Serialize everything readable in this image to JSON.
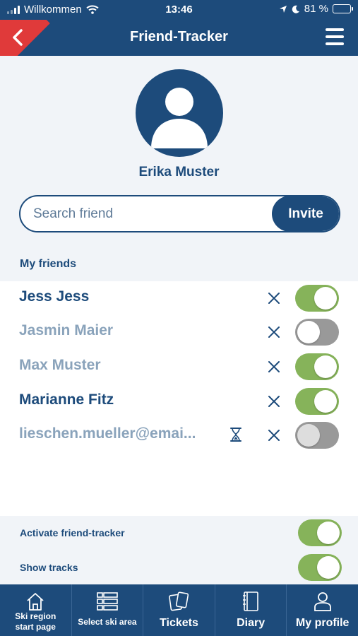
{
  "status_bar": {
    "carrier": "Willkommen",
    "time": "13:46",
    "battery": "81 %",
    "icons": [
      "signal-icon",
      "wifi-icon",
      "location-icon",
      "moon-icon",
      "battery-icon"
    ]
  },
  "header": {
    "title": "Friend-Tracker",
    "back_icon": "chevron-left-icon",
    "menu_icon": "hamburger-menu-icon"
  },
  "profile": {
    "name": "Erika Muster",
    "avatar_icon": "user-avatar-icon"
  },
  "search": {
    "placeholder": "Search friend",
    "value": "",
    "invite_label": "Invite"
  },
  "friends_section": {
    "title": "My friends",
    "friends": [
      {
        "name": "Jess Jess",
        "active": true,
        "tracking": true,
        "pending": false
      },
      {
        "name": "Jasmin Maier",
        "active": false,
        "tracking": false,
        "pending": false
      },
      {
        "name": "Max Muster",
        "active": false,
        "tracking": true,
        "pending": false
      },
      {
        "name": "Marianne Fitz",
        "active": true,
        "tracking": true,
        "pending": false
      },
      {
        "name": "lieschen.mueller@emai...",
        "active": false,
        "tracking": false,
        "pending": true
      }
    ]
  },
  "settings": {
    "activate_tracker": {
      "label": "Activate friend-tracker",
      "on": true
    },
    "show_tracks": {
      "label": "Show tracks",
      "on": true
    }
  },
  "bottom_nav": [
    {
      "label": "Ski region\nstart page",
      "icon": "home-icon"
    },
    {
      "label": "Select ski area",
      "icon": "list-icon"
    },
    {
      "label": "Tickets",
      "icon": "ticket-icon"
    },
    {
      "label": "Diary",
      "icon": "book-icon"
    },
    {
      "label": "My profile",
      "icon": "person-icon"
    }
  ],
  "colors": {
    "primary": "#1d4b7b",
    "accent_red": "#e03a3a",
    "toggle_on": "#86b35a",
    "toggle_off": "#999999",
    "inactive_text": "#8aa3bb"
  }
}
